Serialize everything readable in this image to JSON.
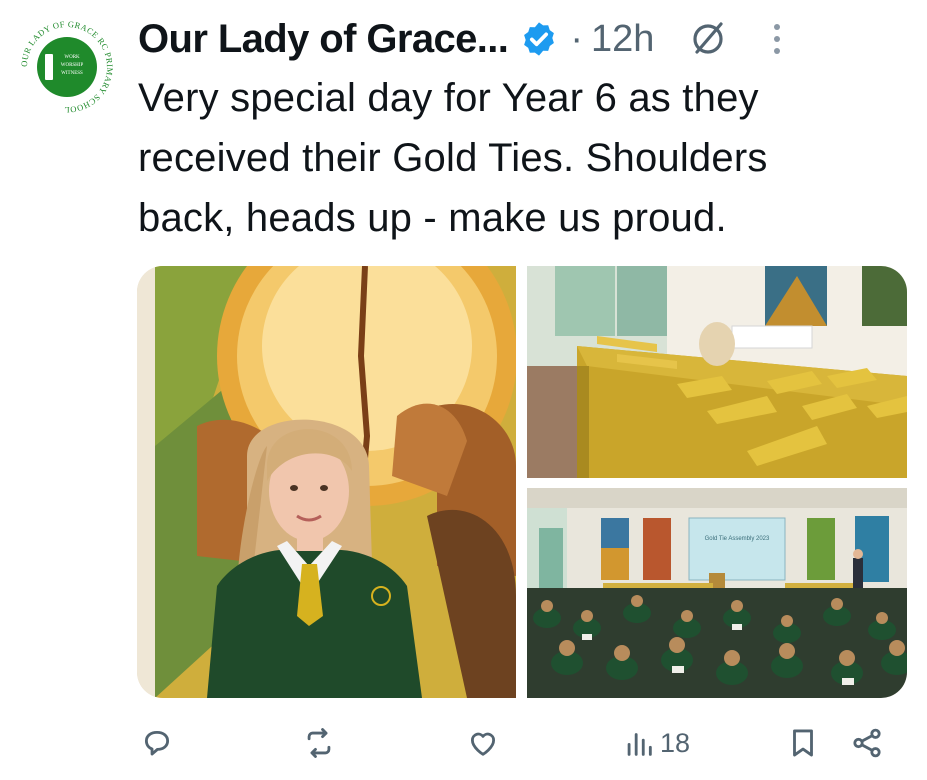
{
  "account": {
    "display_name": "Our Lady of Grace...",
    "verified": true,
    "separator": "·",
    "time_ago": "12h",
    "avatar_ring_text": "OUR LADY OF GRACE RC PRIMARY SCHOOL",
    "avatar_motto": [
      "WORK",
      "WORSHIP",
      "WITNESS"
    ]
  },
  "tweet": {
    "lines": [
      "Very special day for Year 6 as they",
      "received their Gold Ties. Shoulders",
      "back, heads up - make us proud."
    ]
  },
  "media": {
    "photos": [
      "student-portrait",
      "gold-ties-table",
      "assembly-hall"
    ],
    "slide_text": "Gold Tie Assembly 2023"
  },
  "actions": {
    "reply_count": "",
    "repost_count": "",
    "like_count": "",
    "views_count": "18"
  },
  "colors": {
    "accent": "#1d9bf0",
    "muted": "#536471",
    "school_green": "#1f8a2b",
    "tie_gold": "#d6b21f"
  }
}
